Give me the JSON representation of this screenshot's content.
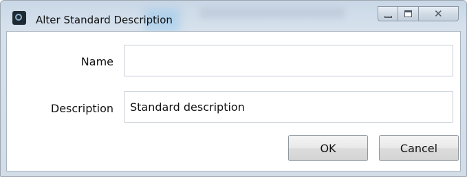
{
  "window": {
    "title": "Alter Standard Description",
    "app_icon": "app-icon",
    "controls": {
      "minimize_icon": "minimize-icon",
      "maximize_icon": "maximize-icon",
      "close_icon": "close-icon",
      "close_glyph": "✕"
    }
  },
  "form": {
    "name_label": "Name",
    "name_value": "",
    "description_label": "Description",
    "description_value": "Standard description"
  },
  "buttons": {
    "ok_label": "OK",
    "cancel_label": "Cancel"
  }
}
